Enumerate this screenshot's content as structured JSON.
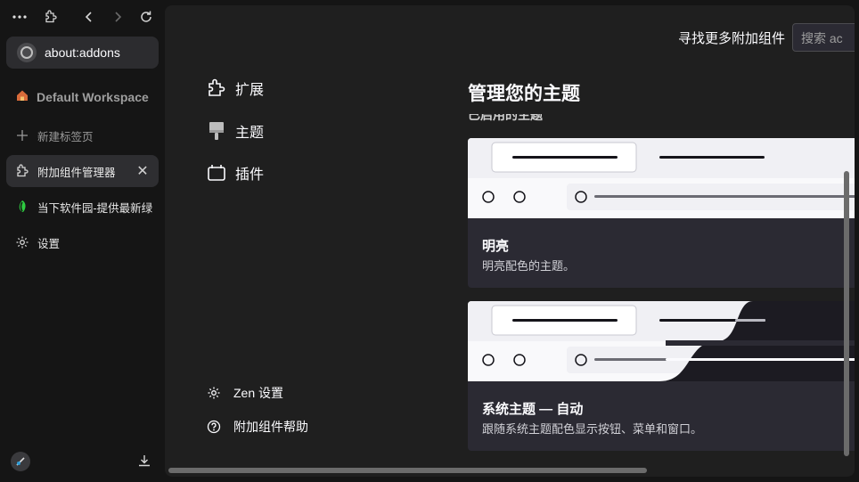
{
  "sidebar": {
    "url": "about:addons",
    "workspace": "Default Workspace",
    "tabs": [
      {
        "label": "新建标签页",
        "icon": "plus-icon"
      },
      {
        "label": "附加组件管理器",
        "icon": "puzzle-icon",
        "active": true
      },
      {
        "label": "当下软件园-提供最新绿",
        "icon": "site-logo-icon"
      },
      {
        "label": "设置",
        "icon": "gear-icon"
      }
    ]
  },
  "header": {
    "find_more": "寻找更多附加组件",
    "search_placeholder": "搜索 ac"
  },
  "categories": [
    {
      "label": "扩展",
      "icon": "puzzle-icon"
    },
    {
      "label": "主题",
      "icon": "brush-icon"
    },
    {
      "label": "插件",
      "icon": "plugin-icon"
    }
  ],
  "bottom_links": [
    {
      "label": "Zen 设置",
      "icon": "gear-icon"
    },
    {
      "label": "附加组件帮助",
      "icon": "help-icon"
    }
  ],
  "main": {
    "heading": "管理您的主题",
    "section_label_partial": "已启用的主题",
    "themes": [
      {
        "title": "明亮",
        "desc": "明亮配色的主题。"
      },
      {
        "title": "系统主题 — 自动",
        "desc": "跟随系统主题配色显示按钮、菜单和窗口。"
      }
    ]
  },
  "colors": {
    "background": "#151515",
    "content_bg": "#1f1f1f",
    "card_bg": "#2b2a33",
    "preview_light": "#f0f0f4",
    "accent_green": "#2ecc40"
  }
}
